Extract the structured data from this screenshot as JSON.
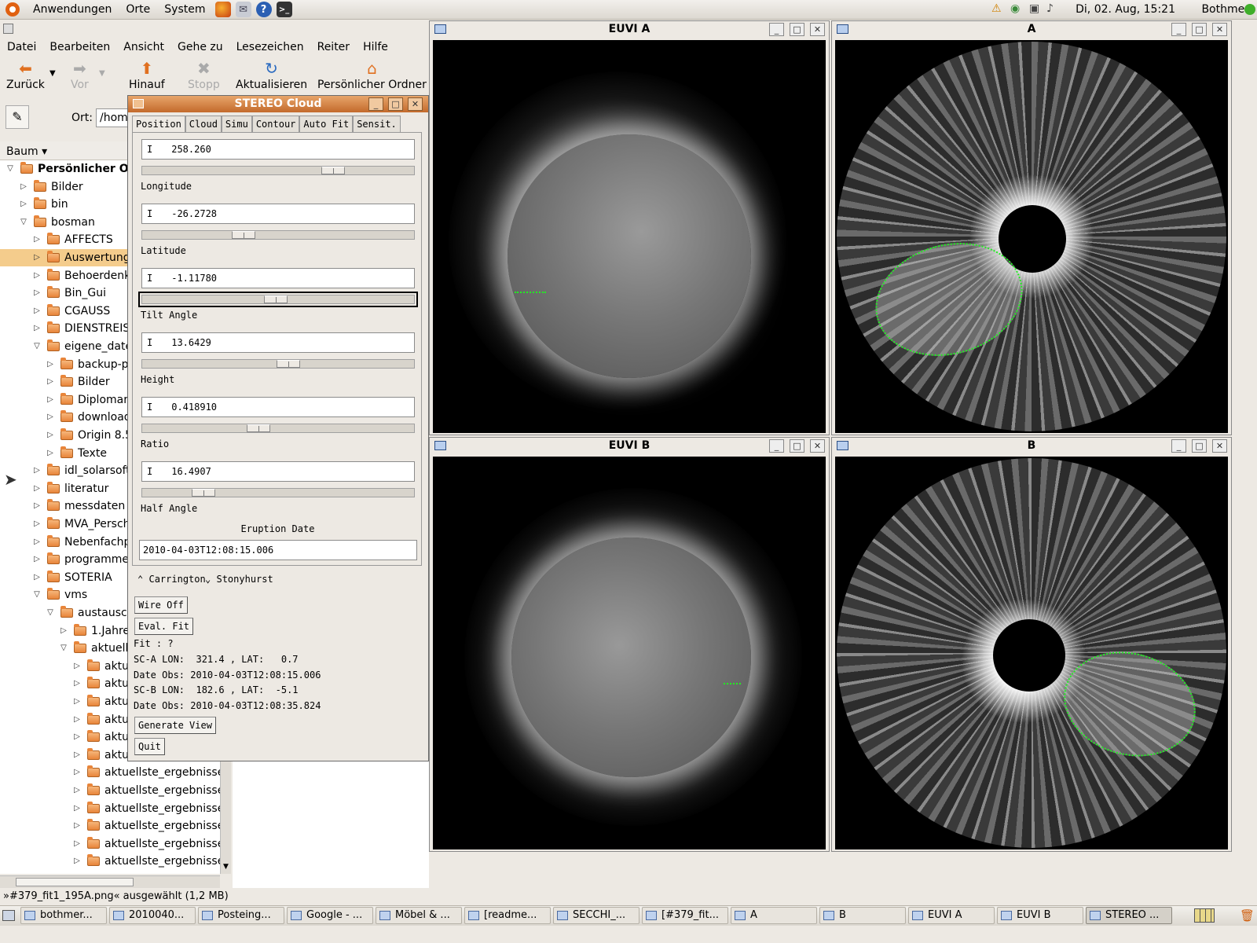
{
  "top_panel": {
    "menus": [
      "Anwendungen",
      "Orte",
      "System"
    ],
    "clock": "Di, 02. Aug, 15:21",
    "user": "Bothmer"
  },
  "file_manager": {
    "menubar": [
      "Datei",
      "Bearbeiten",
      "Ansicht",
      "Gehe zu",
      "Lesezeichen",
      "Reiter",
      "Hilfe"
    ],
    "toolbar": {
      "back": "Zurück",
      "forward": "Vor",
      "up": "Hinauf",
      "stop": "Stopp",
      "reload": "Aktualisieren",
      "home": "Persönlicher Ordner"
    },
    "location_label": "Ort:",
    "location_value": "/hom",
    "view_mode": "Baum",
    "tree": [
      {
        "label": "Persönlicher Ord",
        "depth": 0,
        "expanded": true,
        "bold": true
      },
      {
        "label": "Bilder",
        "depth": 1,
        "expanded": false
      },
      {
        "label": "bin",
        "depth": 1,
        "expanded": false
      },
      {
        "label": "bosman",
        "depth": 1,
        "expanded": true
      },
      {
        "label": "AFFECTS",
        "depth": 2,
        "expanded": false
      },
      {
        "label": "Auswertung",
        "depth": 2,
        "expanded": false,
        "selected": true
      },
      {
        "label": "Behoerdenkra",
        "depth": 2,
        "expanded": false
      },
      {
        "label": "Bin_Gui",
        "depth": 2,
        "expanded": false
      },
      {
        "label": "CGAUSS",
        "depth": 2,
        "expanded": false
      },
      {
        "label": "DIENSTREISEN",
        "depth": 2,
        "expanded": false
      },
      {
        "label": "eigene_dateie",
        "depth": 2,
        "expanded": true
      },
      {
        "label": "backup-pro",
        "depth": 3,
        "expanded": false
      },
      {
        "label": "Bilder",
        "depth": 3,
        "expanded": false
      },
      {
        "label": "Diplomarbe",
        "depth": 3,
        "expanded": false
      },
      {
        "label": "download",
        "depth": 3,
        "expanded": false
      },
      {
        "label": "Origin 8.5",
        "depth": 3,
        "expanded": false
      },
      {
        "label": "Texte",
        "depth": 3,
        "expanded": false
      },
      {
        "label": "idl_solarsoft",
        "depth": 2,
        "expanded": false
      },
      {
        "label": "literatur",
        "depth": 2,
        "expanded": false
      },
      {
        "label": "messdaten",
        "depth": 2,
        "expanded": false
      },
      {
        "label": "MVA_Perschke",
        "depth": 2,
        "expanded": false
      },
      {
        "label": "Nebenfachpra",
        "depth": 2,
        "expanded": false
      },
      {
        "label": "programme",
        "depth": 2,
        "expanded": false
      },
      {
        "label": "SOTERIA",
        "depth": 2,
        "expanded": false
      },
      {
        "label": "vms",
        "depth": 2,
        "expanded": true
      },
      {
        "label": "austausch",
        "depth": 3,
        "expanded": true
      },
      {
        "label": "1.Jahres",
        "depth": 4,
        "expanded": false
      },
      {
        "label": "aktuelle_",
        "depth": 4,
        "expanded": true
      },
      {
        "label": "aktue",
        "depth": 5,
        "expanded": false
      },
      {
        "label": "aktue",
        "depth": 5,
        "expanded": false
      },
      {
        "label": "aktue",
        "depth": 5,
        "expanded": false
      },
      {
        "label": "aktue",
        "depth": 5,
        "expanded": false
      },
      {
        "label": "aktue",
        "depth": 5,
        "expanded": false
      },
      {
        "label": "aktue",
        "depth": 5,
        "expanded": false
      },
      {
        "label": "aktuellste_ergebnisse_j",
        "depth": 5,
        "expanded": false
      },
      {
        "label": "aktuellste_ergebnisse_j",
        "depth": 5,
        "expanded": false
      },
      {
        "label": "aktuellste_ergebnisse_r",
        "depth": 5,
        "expanded": false
      },
      {
        "label": "aktuellste_ergebnisse_r",
        "depth": 5,
        "expanded": false
      },
      {
        "label": "aktuellste_ergebnisse_r",
        "depth": 5,
        "expanded": false
      },
      {
        "label": "aktuellste_ergebnisse_",
        "depth": 5,
        "expanded": false
      }
    ],
    "status": "»#379_fit1_195A.png« ausgewählt (1,2 MB)"
  },
  "stereo_cloud": {
    "title": "STEREO Cloud",
    "tabs": [
      "Position",
      "Cloud",
      "Simu",
      "Contour",
      "Auto Fit",
      "Sensit."
    ],
    "active_tab": "Position",
    "params": [
      {
        "label": "Longitude",
        "value": "258.260",
        "slider_fraction": 0.72
      },
      {
        "label": "Latitude",
        "value": "-26.2728",
        "slider_fraction": 0.36
      },
      {
        "label": "Tilt Angle",
        "value": "-1.11780",
        "slider_fraction": 0.49
      },
      {
        "label": "Height",
        "value": "13.6429",
        "slider_fraction": 0.54
      },
      {
        "label": "Ratio",
        "value": "0.418910",
        "slider_fraction": 0.42
      },
      {
        "label": "Half Angle",
        "value": "16.4907",
        "slider_fraction": 0.2
      }
    ],
    "eruption_date_label": "Eruption Date",
    "eruption_date": "2010-04-03T12:08:15.006",
    "coord_options": [
      "Carrington",
      "Stonyhurst"
    ],
    "wire_off_button": "Wire Off",
    "eval_fit_button": "Eval. Fit",
    "fit_text": "Fit : ?",
    "sca_info": "SC-A LON:  321.4 , LAT:   0.7",
    "sca_date": "Date Obs: 2010-04-03T12:08:15.006",
    "scb_info": "SC-B LON:  182.6 , LAT:  -5.1",
    "scb_date": "Date Obs: 2010-04-03T12:08:35.824",
    "generate_view_button": "Generate View",
    "quit_button": "Quit"
  },
  "image_windows": {
    "euvi_a": "EUVI A",
    "cor_a": "A",
    "euvi_b": "EUVI B",
    "cor_b": "B"
  },
  "taskbar": [
    {
      "label": "bothmer...",
      "active": false
    },
    {
      "label": "2010040...",
      "active": false
    },
    {
      "label": "Posteing...",
      "active": false
    },
    {
      "label": "Google - ...",
      "active": false
    },
    {
      "label": "Möbel & ...",
      "active": false
    },
    {
      "label": "[readme...",
      "active": false
    },
    {
      "label": "SECCHI_...",
      "active": false
    },
    {
      "label": "[#379_fit...",
      "active": false
    },
    {
      "label": "A",
      "active": false
    },
    {
      "label": "B",
      "active": false
    },
    {
      "label": "EUVI A",
      "active": false
    },
    {
      "label": "EUVI B",
      "active": false
    },
    {
      "label": "STEREO ...",
      "active": true
    }
  ],
  "colors": {
    "panel_bg": "#ede9e3",
    "selection": "#f4cc8c",
    "titlebar_active": "#c36a2b",
    "cme_wireframe": "#22ee22"
  }
}
